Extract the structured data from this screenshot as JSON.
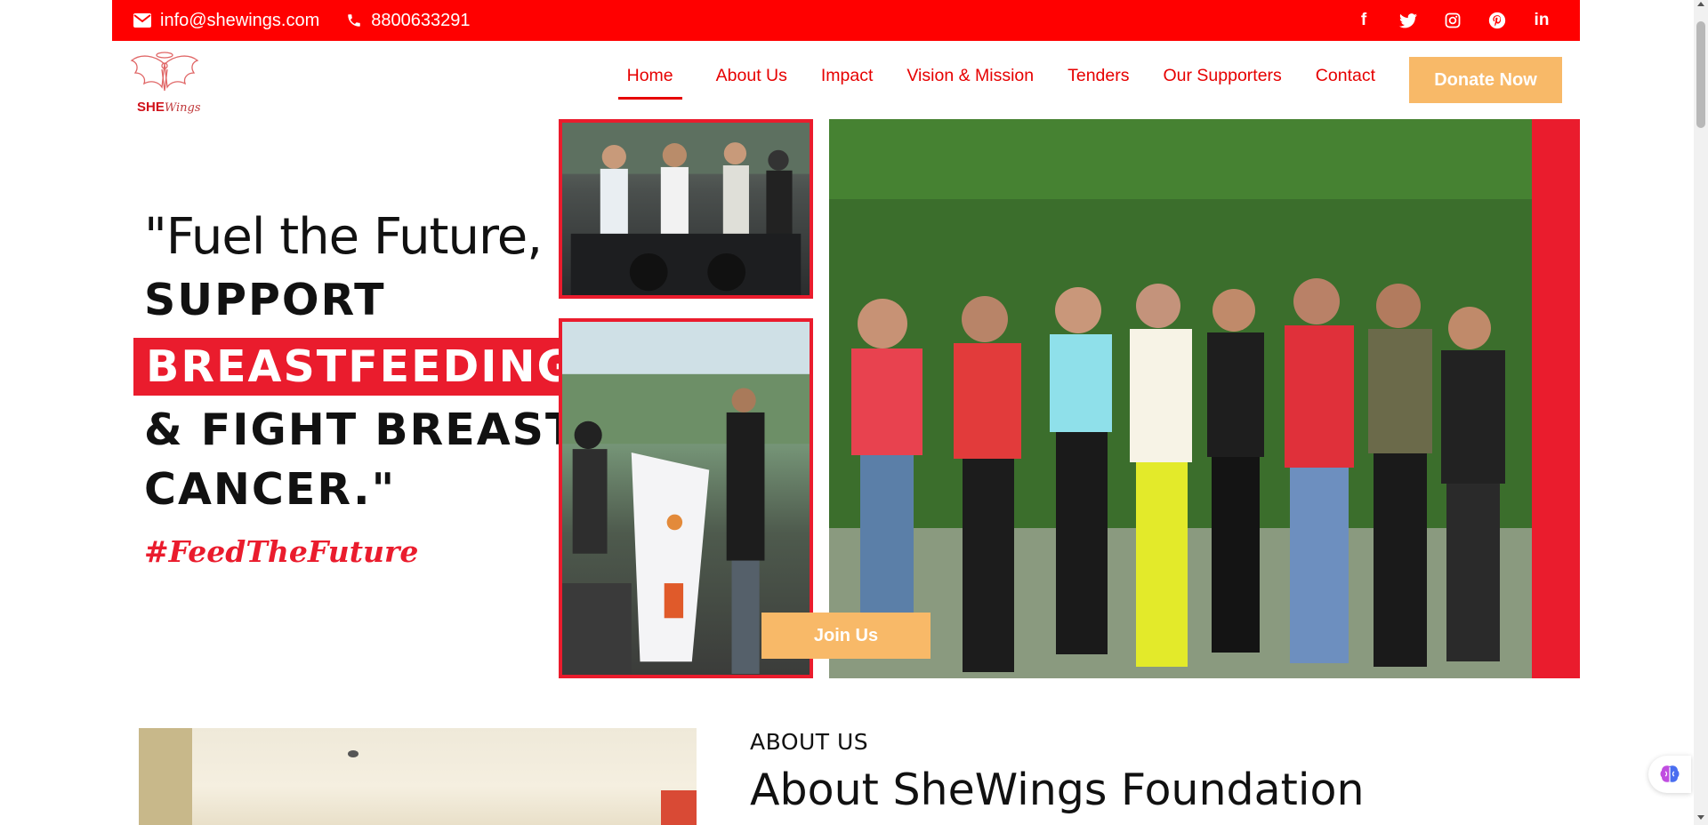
{
  "topbar": {
    "email": "info@shewings.com",
    "phone": "8800633291",
    "social_icons": [
      "facebook-icon",
      "twitter-icon",
      "instagram-icon",
      "pinterest-icon",
      "linkedin-icon"
    ],
    "facebook_glyph": "f",
    "linkedin_glyph": "in"
  },
  "logo": {
    "brand_bold": "SHE",
    "brand_script": "Wings"
  },
  "nav": {
    "items": [
      {
        "label": "Home",
        "active": true
      },
      {
        "label": "About Us"
      },
      {
        "label": "Impact"
      },
      {
        "label": "Vision & Mission"
      },
      {
        "label": "Tenders"
      },
      {
        "label": "Our Supporters"
      },
      {
        "label": "Contact"
      }
    ],
    "donate_label": "Donate Now"
  },
  "hero": {
    "line1": "\"Fuel the Future,",
    "line2": "SUPPORT",
    "line3": "BREASTFEEDING",
    "line4": "& FIGHT BREAST",
    "line5": "CANCER.\"",
    "hashtag": "#FeedTheFuture",
    "join_label": "Join Us"
  },
  "about": {
    "kicker": "ABOUT US",
    "title": "About SheWings Foundation"
  },
  "colors": {
    "brand_red": "#ff0000",
    "nav_red": "#e60000",
    "accent_orange": "#f8b968",
    "highlight_red": "#ea1c2d"
  }
}
